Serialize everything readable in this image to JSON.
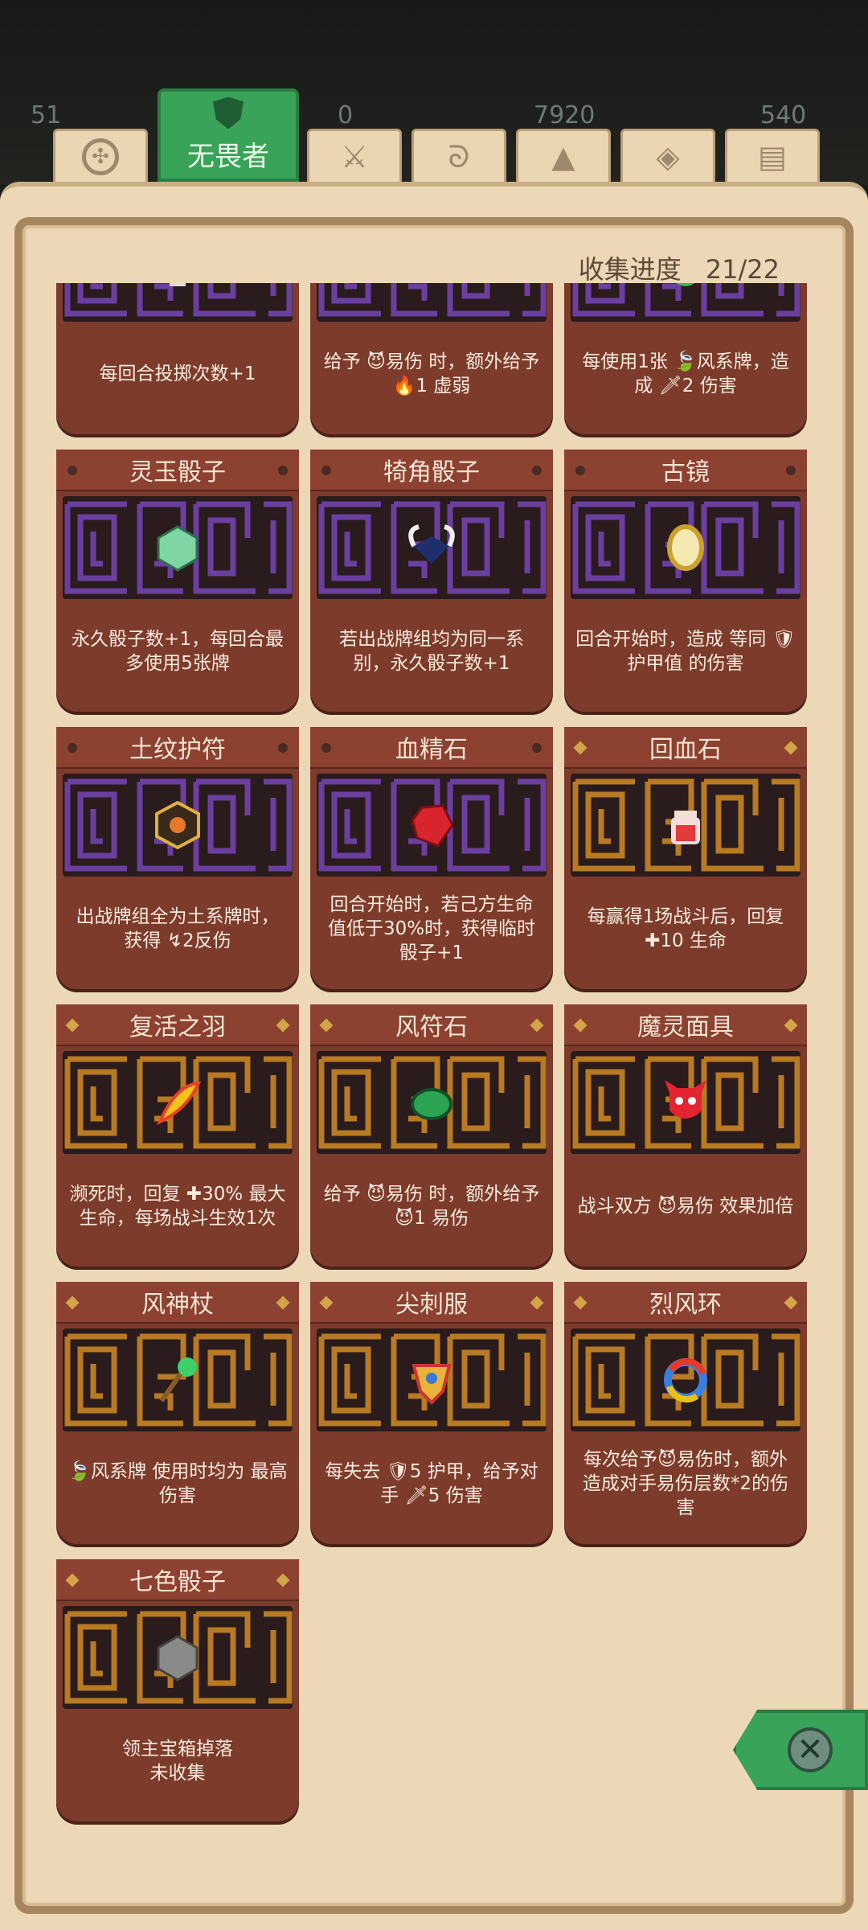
{
  "header": {
    "resources": [
      {
        "name": "resource-1",
        "value": "51"
      },
      {
        "name": "resource-2",
        "value": "0"
      },
      {
        "name": "resource-3",
        "value": "7920"
      },
      {
        "name": "resource-4",
        "value": "540"
      }
    ],
    "active_tab": {
      "label": "无畏者",
      "icon": "shield-icon"
    },
    "tabs": [
      {
        "icon": "dice-circle-icon"
      },
      {
        "icon": "crossed-swords-icon"
      },
      {
        "icon": "wind-swirl-icon"
      },
      {
        "icon": "triangle-rune-icon"
      },
      {
        "icon": "eye-rune-icon"
      },
      {
        "icon": "gold-bars-icon"
      }
    ]
  },
  "collection": {
    "label": "收集进度",
    "value": "21/22"
  },
  "relics": [
    {
      "title": "",
      "desc": "每回合投掷次数+1",
      "maze": "purple",
      "icon": "skull-icon"
    },
    {
      "title": "",
      "desc": "给予 😈易伤 时，额外给予 🔥1 虚弱",
      "maze": "purple",
      "icon": "scroll-icon"
    },
    {
      "title": "",
      "desc": "每使用1张 🍃风系牌，造成 🗡2 伤害",
      "maze": "purple",
      "icon": "leaf-orb-icon"
    },
    {
      "title": "灵玉骰子",
      "desc": "永久骰子数+1，每回合最多使用5张牌",
      "maze": "purple",
      "icon": "jade-dice-icon"
    },
    {
      "title": "犄角骰子",
      "desc": "若出战牌组均为同一系别，永久骰子数+1",
      "maze": "purple",
      "icon": "horn-dice-icon"
    },
    {
      "title": "古镜",
      "desc": "回合开始时，造成 等同 🛡护甲值 的伤害",
      "maze": "purple",
      "icon": "mirror-icon"
    },
    {
      "title": "土纹护符",
      "desc": "出战牌组全为土系牌时，获得 ↯2反伤",
      "maze": "purple",
      "icon": "earth-amulet-icon"
    },
    {
      "title": "血精石",
      "desc": "回合开始时，若己方生命值低于30%时，获得临时骰子+1",
      "maze": "purple",
      "icon": "blood-gem-icon"
    },
    {
      "title": "回血石",
      "desc": "每赢得1场战斗后，回复 ✚10 生命",
      "maze": "gold",
      "icon": "potion-jar-icon"
    },
    {
      "title": "复活之羽",
      "desc": "濒死时，回复 ✚30% 最大生命，每场战斗生效1次",
      "maze": "gold",
      "icon": "phoenix-feather-icon"
    },
    {
      "title": "风符石",
      "desc": "给予 😈易伤 时，额外给予 😈1 易伤",
      "maze": "gold",
      "icon": "wind-stone-icon"
    },
    {
      "title": "魔灵面具",
      "desc": "战斗双方 😈易伤 效果加倍",
      "maze": "gold",
      "icon": "demon-mask-icon"
    },
    {
      "title": "风神杖",
      "desc": "🍃风系牌 使用时均为 最高伤害",
      "maze": "gold",
      "icon": "wind-staff-icon"
    },
    {
      "title": "尖刺服",
      "desc": "每失去 🛡5 护甲，给予对手 🗡5 伤害",
      "maze": "gold",
      "icon": "spike-armor-icon"
    },
    {
      "title": "烈风环",
      "desc": "每次给予😈易伤时，额外造成对手易伤层数*2的伤害",
      "maze": "gold",
      "icon": "gale-ring-icon"
    },
    {
      "title": "七色骰子",
      "desc": "领主宝箱掉落\n未收集",
      "maze": "gold",
      "icon": "stone-dice-icon"
    }
  ],
  "colors": {
    "card": "#7d3b2b",
    "maze_purple": "#6b3fa0",
    "maze_gold": "#b87a22",
    "accent_green": "#3aa35a",
    "parchment": "#ecd8b6"
  }
}
